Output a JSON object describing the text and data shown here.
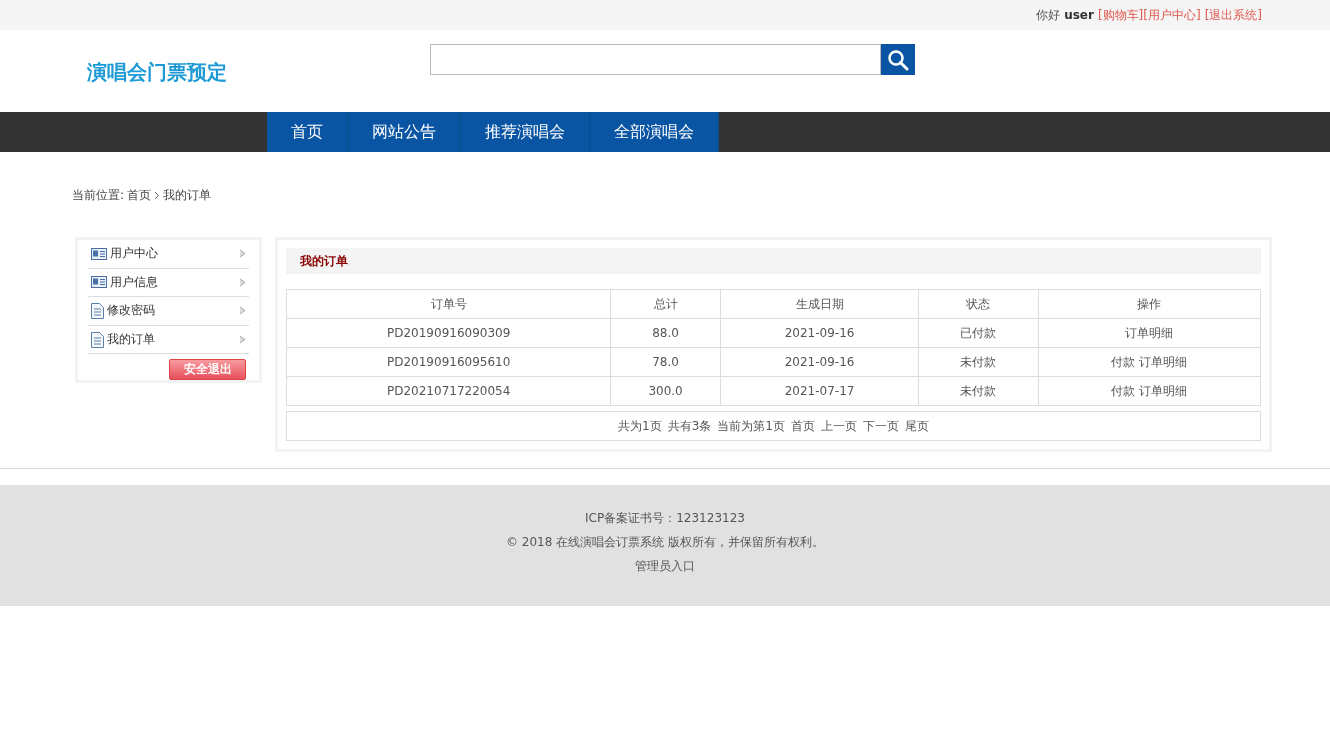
{
  "top_bar": {
    "greeting": "你好",
    "username": "user",
    "links": [
      "[购物车]",
      "[用户中心]",
      "[退出系统]"
    ]
  },
  "header": {
    "logo": "演唱会门票预定"
  },
  "nav": [
    "首页",
    "网站公告",
    "推荐演唱会",
    "全部演唱会"
  ],
  "breadcrumb": {
    "label": "当前位置:",
    "items": [
      "首页",
      "我的订单"
    ]
  },
  "sidebar": {
    "items": [
      {
        "label": "用户中心",
        "kind": "card"
      },
      {
        "label": "用户信息",
        "kind": "card"
      },
      {
        "label": "修改密码",
        "kind": "doc"
      },
      {
        "label": "我的订单",
        "kind": "doc"
      }
    ],
    "logout_button": "安全退出"
  },
  "panel": {
    "title": "我的订单",
    "table": {
      "columns": [
        "订单号",
        "总计",
        "生成日期",
        "状态",
        "操作"
      ],
      "rows": [
        {
          "order_no": "PD20190916090309",
          "total": "88.0",
          "date": "2021-09-16",
          "status": "已付款",
          "actions": [
            "订单明细"
          ]
        },
        {
          "order_no": "PD20190916095610",
          "total": "78.0",
          "date": "2021-09-16",
          "status": "未付款",
          "actions": [
            "付款",
            "订单明细"
          ]
        },
        {
          "order_no": "PD20210717220054",
          "total": "300.0",
          "date": "2021-07-17",
          "status": "未付款",
          "actions": [
            "付款",
            "订单明细"
          ]
        }
      ]
    },
    "pager": [
      "共为1页",
      "共有3条",
      "当前为第1页",
      "首页",
      "上一页",
      "下一页",
      "尾页"
    ]
  },
  "footer": {
    "lines": [
      "ICP备案证书号：123123123",
      "© 2018 在线演唱会订票系统 版权所有，并保留所有权利。"
    ],
    "admin_link": "管理员入口"
  }
}
